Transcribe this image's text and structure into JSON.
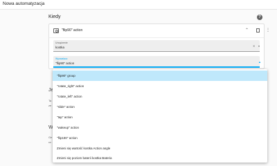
{
  "topbar": {
    "title": "Nowa automatyzacja"
  },
  "section": {
    "title": "Kiedy",
    "help_icon": "help-circle-icon",
    "help_glyph": "?"
  },
  "trigger_card": {
    "title": "\"flip90\" action",
    "icons": {
      "device": "remote-icon",
      "collapse": "chevron-up-icon",
      "copy": "copy-icon",
      "menu": "dots-vertical-icon"
    },
    "collapse_glyph": "⌃",
    "menu_glyph": "⋮",
    "device_field": {
      "label": "Urządzenie",
      "value": "kostka",
      "clear_glyph": "✕",
      "arrow_glyph": "▾"
    },
    "trigger_field": {
      "label": "Wyzwalacz",
      "value": "\"flip90\" action",
      "arrow_glyph": "▲"
    }
  },
  "background": {
    "je_fragment": "Je",
    "ta_fragment": "Ta",
    "ta2_fragment": "ze",
    "w_fragment": "W",
    "ge_fragment": "Ge",
    "cc_fragment": "cc"
  },
  "dropdown": {
    "selected_index": 0,
    "options": [
      "\"flip90\" group",
      "\"rotate_right\" action",
      "\"rotate_left\" action",
      "\"slide\" action",
      "\"tap\" action",
      "\"wakeup\" action",
      "\"flip180\" action",
      "Zmieni się wartość kostka Action angle",
      "Zmieni się poziom baterii kostka Bateria"
    ]
  },
  "colors": {
    "accent": "#03a9f4",
    "selected_bg": "#bfe8fb",
    "field_bg": "#eeeeee"
  }
}
